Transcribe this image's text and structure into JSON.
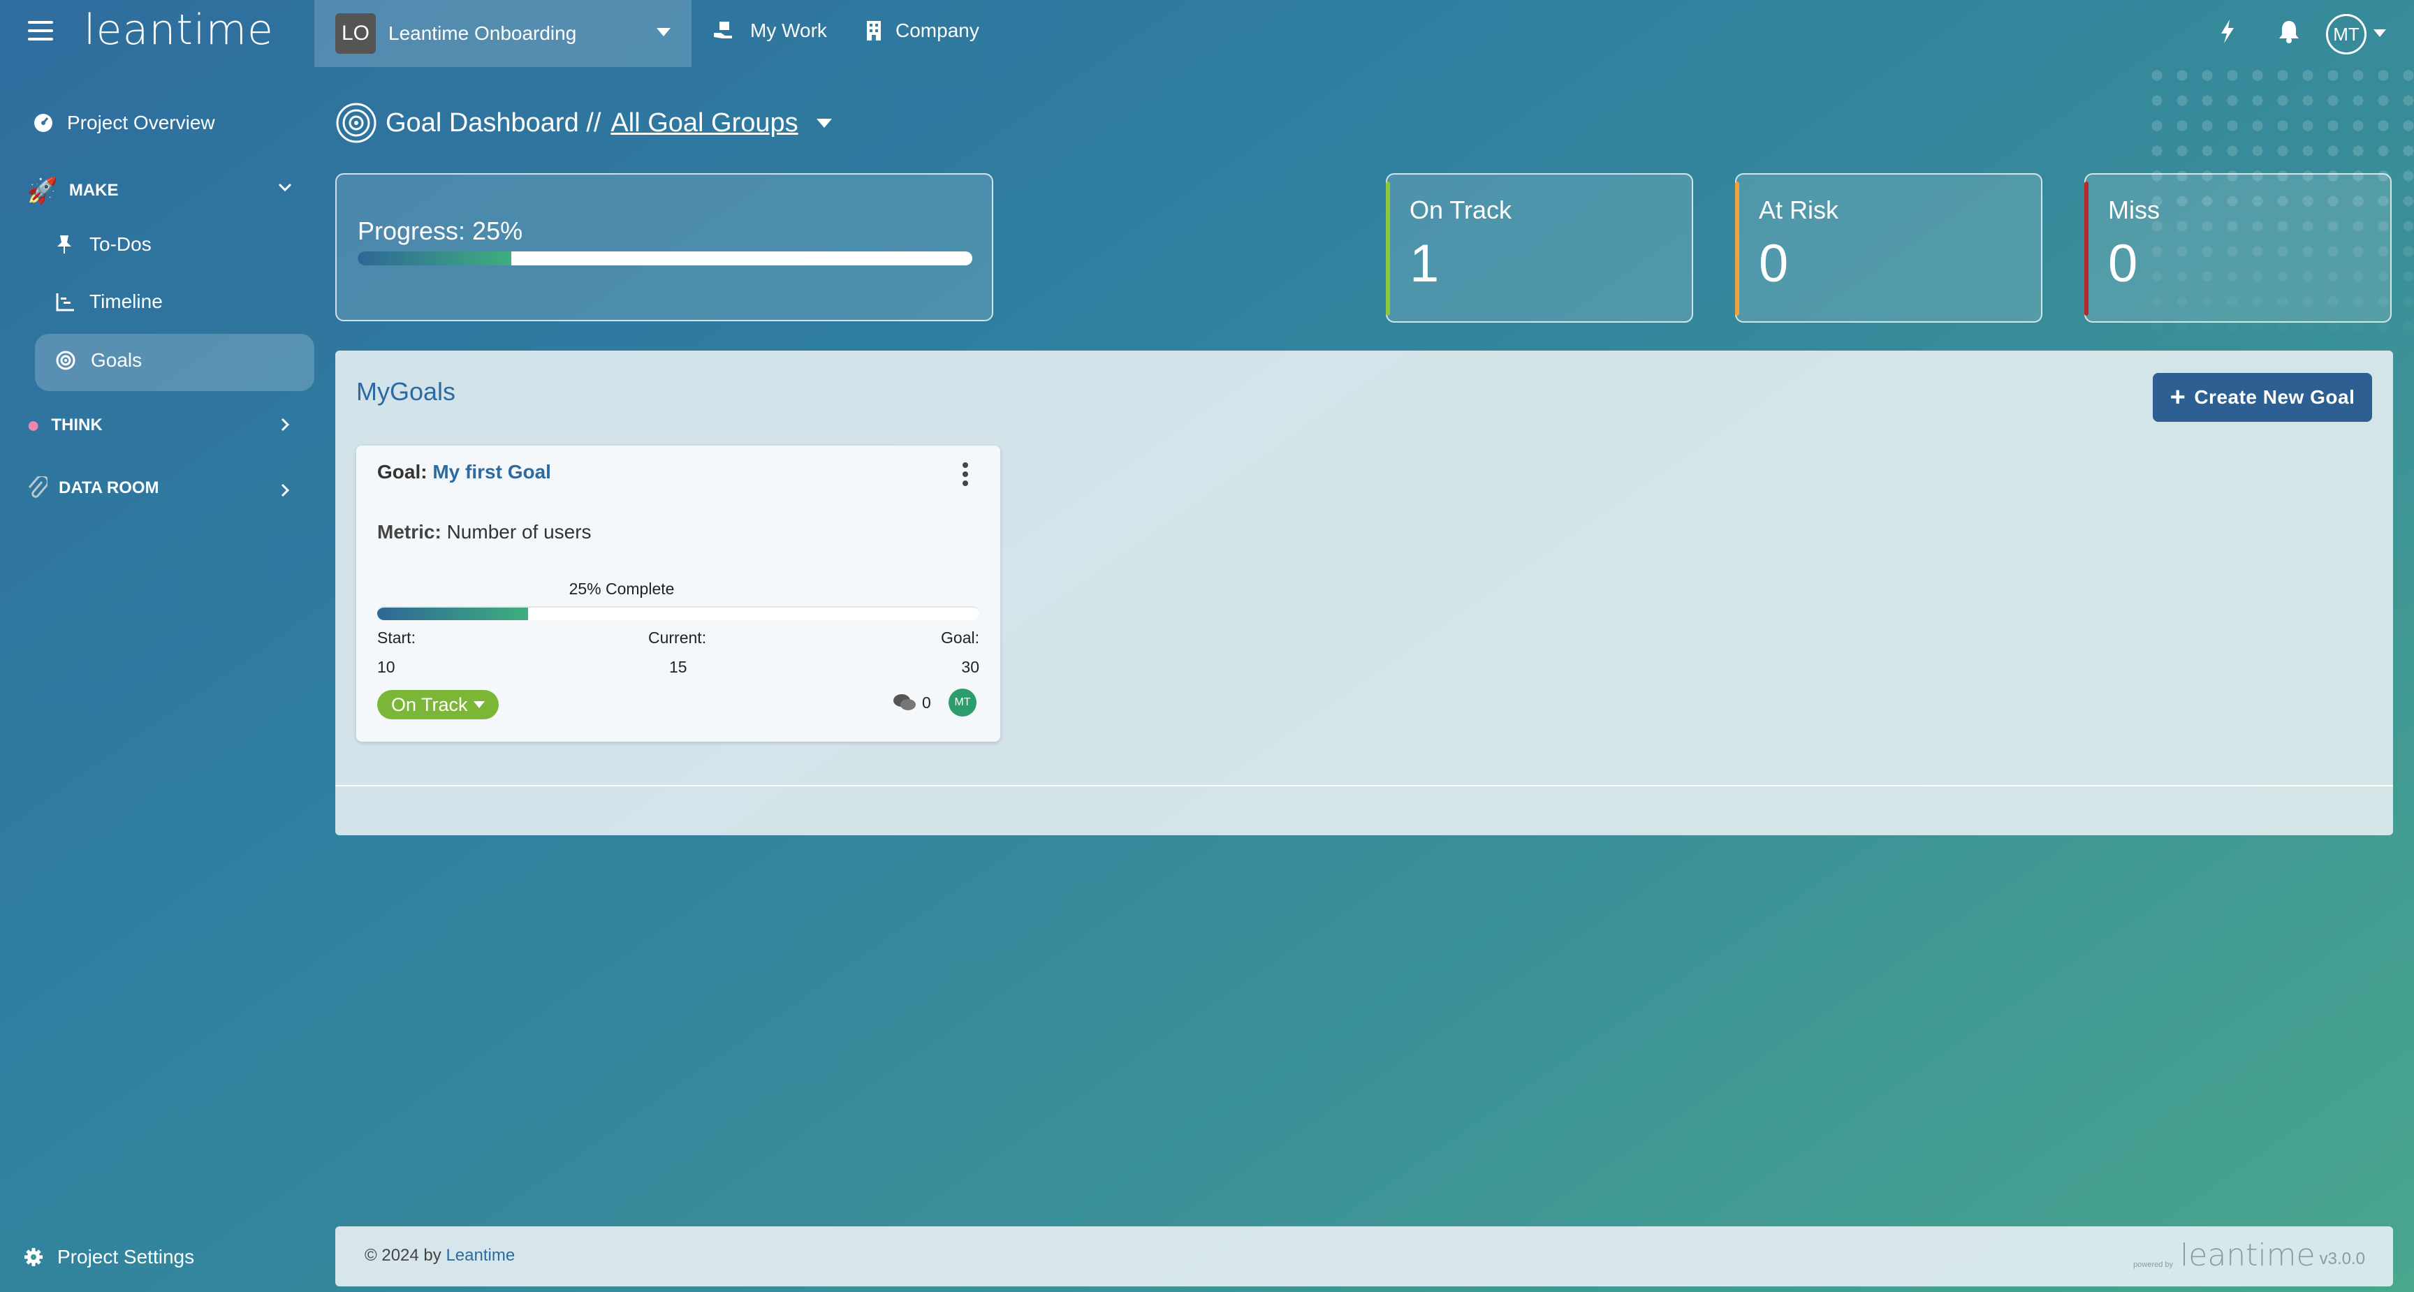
{
  "header": {
    "logo": "leantime",
    "project_badge": "LO",
    "project_name": "Leantime Onboarding",
    "nav": {
      "my_work": "My Work",
      "company": "Company"
    },
    "user_initials": "MT"
  },
  "sidebar": {
    "project_overview": "Project Overview",
    "groups": {
      "make": "MAKE",
      "think": "THINK",
      "data_room": "DATA ROOM"
    },
    "items": {
      "todos": "To-Dos",
      "timeline": "Timeline",
      "goals": "Goals"
    },
    "project_settings": "Project Settings"
  },
  "page": {
    "title": "Goal Dashboard //",
    "group_filter": "All Goal Groups"
  },
  "summary": {
    "progress_label": "Progress: 25%",
    "progress_value": 0.25,
    "on_track": {
      "label": "On Track",
      "value": "1",
      "color": "#8dc63f"
    },
    "at_risk": {
      "label": "At Risk",
      "value": "0",
      "color": "#f0a23b"
    },
    "miss": {
      "label": "Miss",
      "value": "0",
      "color": "#b52a2a"
    }
  },
  "goals": {
    "section_title": "MyGoals",
    "create_label": "Create New Goal",
    "card": {
      "goal_prefix": "Goal:",
      "goal_name": "My first Goal",
      "metric_prefix": "Metric:",
      "metric": "Number of users",
      "complete_label": "25% Complete",
      "complete_value": 0.25,
      "start_label": "Start:",
      "start_value": "10",
      "current_label": "Current:",
      "current_value": "15",
      "goal_label": "Goal:",
      "goal_value": "30",
      "status": "On Track",
      "comments": "0",
      "assignee": "MT"
    }
  },
  "footer": {
    "copyright": "© 2024 by",
    "company": "Leantime",
    "powered_by": "powered by",
    "brand": "leantime",
    "version": "v3.0.0"
  },
  "colors": {
    "accent": "#2d5f92",
    "link": "#2d6a9f",
    "status_on_track": "#7cb637",
    "avatar": "#2e9c6d"
  }
}
